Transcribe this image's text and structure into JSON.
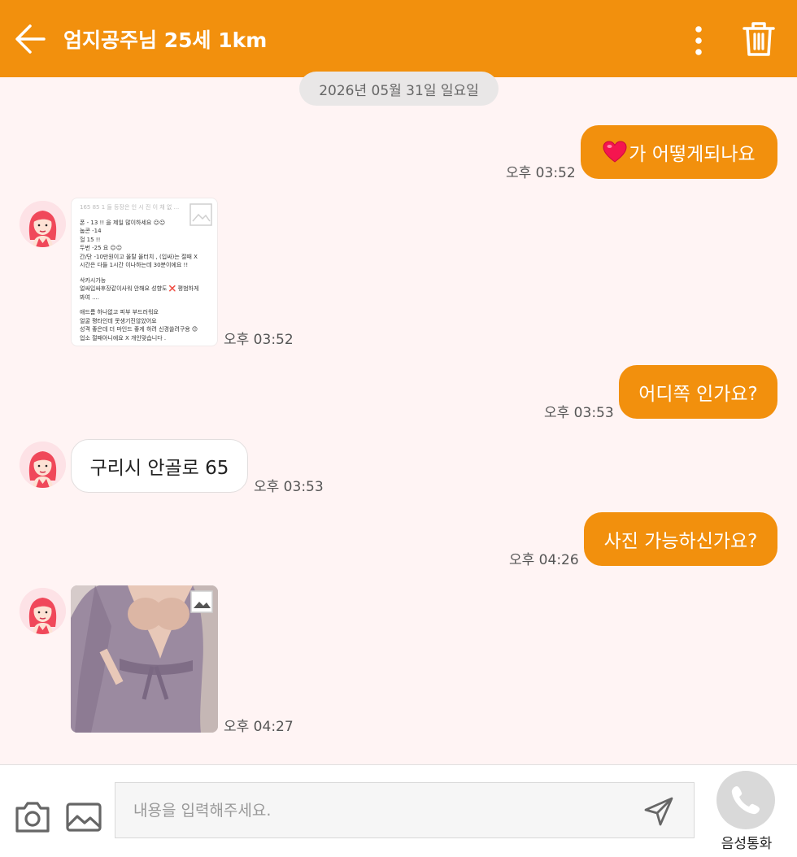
{
  "header": {
    "title": "엄지공주님 25세 1km",
    "icons": {
      "back": "arrow-left-icon",
      "menu": "more-vertical-icon",
      "delete": "trash-icon"
    }
  },
  "date_divider": "2026년 05월 31일 일요일",
  "messages": [
    {
      "direction": "out",
      "type": "text",
      "text": "가 어떻게되나요",
      "prefix_icon": "heart-icon",
      "time": "오후 03:52"
    },
    {
      "direction": "in",
      "type": "image",
      "time": "오후 03:52",
      "image_text": [
        "165 85 1 들 등장은 인 시 진 이 채 없 ...",
        "폰 - 13 !! 을 제일 많이하세요 ☺☺",
        "눕콘 -14",
        "헐 15 !!",
        "두번 -25 요 ☺☺",
        "간/단 -10만원이고 올탈 올터치 , (입싸)는 절때 X",
        "시간은 다들 1시간 이나하는데 30분이에요 !!",
        "",
        "삭카시가능",
        "얼싸입싸후장같이사워 안해요 성향도 ❌ 평범하게",
        "봐여 ....",
        "",
        "애드름 하나없고 피부 부드러워요",
        "얼굴 평타인데 못생기진않았어요",
        "성격 좋은데 더 마인드 좋게 하려 신경쓸려구용 😊",
        "업소 절때아니에요 X 개인맞습니다 ."
      ]
    },
    {
      "direction": "out",
      "type": "text",
      "text": "어디쪽 인가요?",
      "time": "오후 03:53"
    },
    {
      "direction": "in",
      "type": "text",
      "text": "구리시 안골로 65",
      "time": "오후 03:53"
    },
    {
      "direction": "out",
      "type": "text",
      "text": "사진 가능하신가요?",
      "time": "오후 04:26"
    },
    {
      "direction": "in",
      "type": "image",
      "time": "오후 04:27",
      "image_subject": "photo"
    }
  ],
  "composer": {
    "placeholder": "내용을 입력해주세요.",
    "value": "",
    "icons": {
      "camera": "camera-icon",
      "gallery": "image-gallery-icon",
      "send": "send-icon",
      "call": "phone-icon"
    },
    "call_label": "음성통화"
  },
  "colors": {
    "accent": "#f2900d",
    "background": "#fff4f4",
    "incoming_bubble": "#ffffff"
  }
}
